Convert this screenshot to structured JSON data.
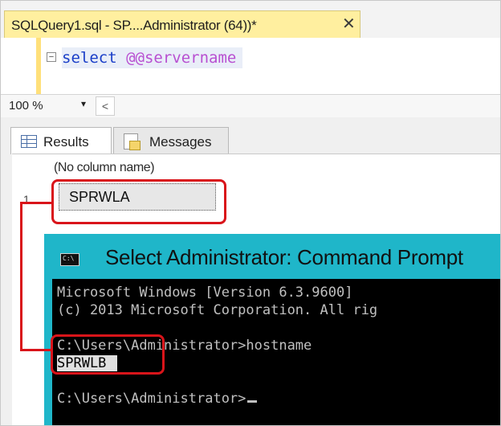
{
  "document_tab": {
    "title": "SQLQuery1.sql - SP....Administrator (64))*",
    "close_icon": "close-icon"
  },
  "editor": {
    "fold_glyph": "−",
    "keyword": "select",
    "variable": "@@servername"
  },
  "zoom": {
    "value": "100 %",
    "arrow": "▾",
    "scroll_left": "<"
  },
  "results_tabs": {
    "results_label": "Results",
    "results_icon": "grid-icon",
    "messages_label": "Messages",
    "messages_icon": "messages-icon"
  },
  "grid": {
    "column_header": "(No column name)",
    "rows": [
      {
        "num": "1",
        "value": "SPRWLA"
      }
    ]
  },
  "cmd": {
    "title": "Select Administrator: Command Prompt",
    "lines": [
      "Microsoft Windows [Version 6.3.9600]",
      "(c) 2013 Microsoft Corporation. All rig",
      "C:\\Users\\Administrator>hostname",
      "SPRWLB",
      "C:\\Users\\Administrator>"
    ]
  },
  "colors": {
    "annotation_red": "#d9141a",
    "tab_yellow": "#ffef9f",
    "cmd_title_cyan": "#1fb6c9"
  }
}
